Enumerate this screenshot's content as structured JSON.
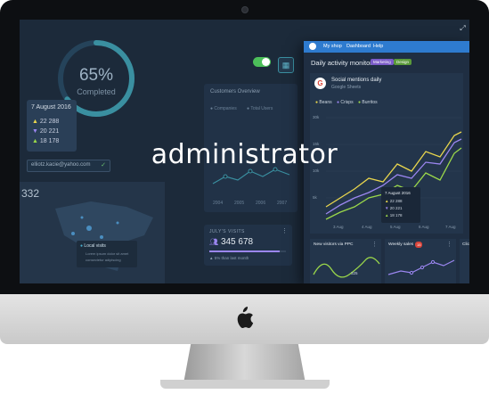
{
  "overlay_word": "administrator",
  "dashboard_bg": {
    "progress": {
      "percent_label": "65%",
      "status": "Completed",
      "value": 0.65
    },
    "date_card": {
      "date": "7 August 2016",
      "rows": [
        {
          "value": "22 288",
          "color": "#e9d64d"
        },
        {
          "value": "20 221",
          "color": "#9b86f0"
        },
        {
          "value": "18 178",
          "color": "#9bd84a"
        }
      ]
    },
    "email_input": "elliotz.kacie@yahoo.com",
    "map": {
      "count": "332",
      "legend_title": "Local visits",
      "legend_line1": "Lorem ipsum dolor sit amet",
      "legend_line2": "consectetur adipiscing"
    },
    "customers_chart": {
      "title": "Customers Overview",
      "legend": [
        "Companies",
        "Total Users"
      ],
      "years": [
        "2004",
        "2005",
        "2006",
        "2007"
      ]
    },
    "visits": {
      "title": "JULY'S VISITS",
      "value": "345 678",
      "note": "5% than last month"
    }
  },
  "window": {
    "menu": [
      "My shop",
      "Dashboard",
      "Help"
    ],
    "title": "Daily activity monitor",
    "tags": [
      "Marketing",
      "Design"
    ],
    "social": {
      "title": "Social mentions daily",
      "subtitle": "Google Sheets"
    },
    "legend": [
      {
        "name": "Beans",
        "color": "#e9d64d"
      },
      {
        "name": "Crisps",
        "color": "#9b86f0"
      },
      {
        "name": "Burritos",
        "color": "#9bd84a"
      }
    ],
    "y_ticks": [
      "30k",
      "15k",
      "10k",
      "5k"
    ],
    "x_ticks": [
      "3 Aug",
      "4 Aug",
      "5 Aug",
      "6 Aug",
      "7 Aug"
    ],
    "tooltip": {
      "date": "7 August 2016",
      "values": [
        "22 288",
        "20 221",
        "18 178"
      ]
    },
    "panels": [
      {
        "title": "New visitors via PPC",
        "badge": "",
        "value": "325"
      },
      {
        "title": "Weekly sales",
        "badge": "15",
        "value": ""
      },
      {
        "title": "Clic",
        "badge": "",
        "value": ""
      }
    ]
  }
}
